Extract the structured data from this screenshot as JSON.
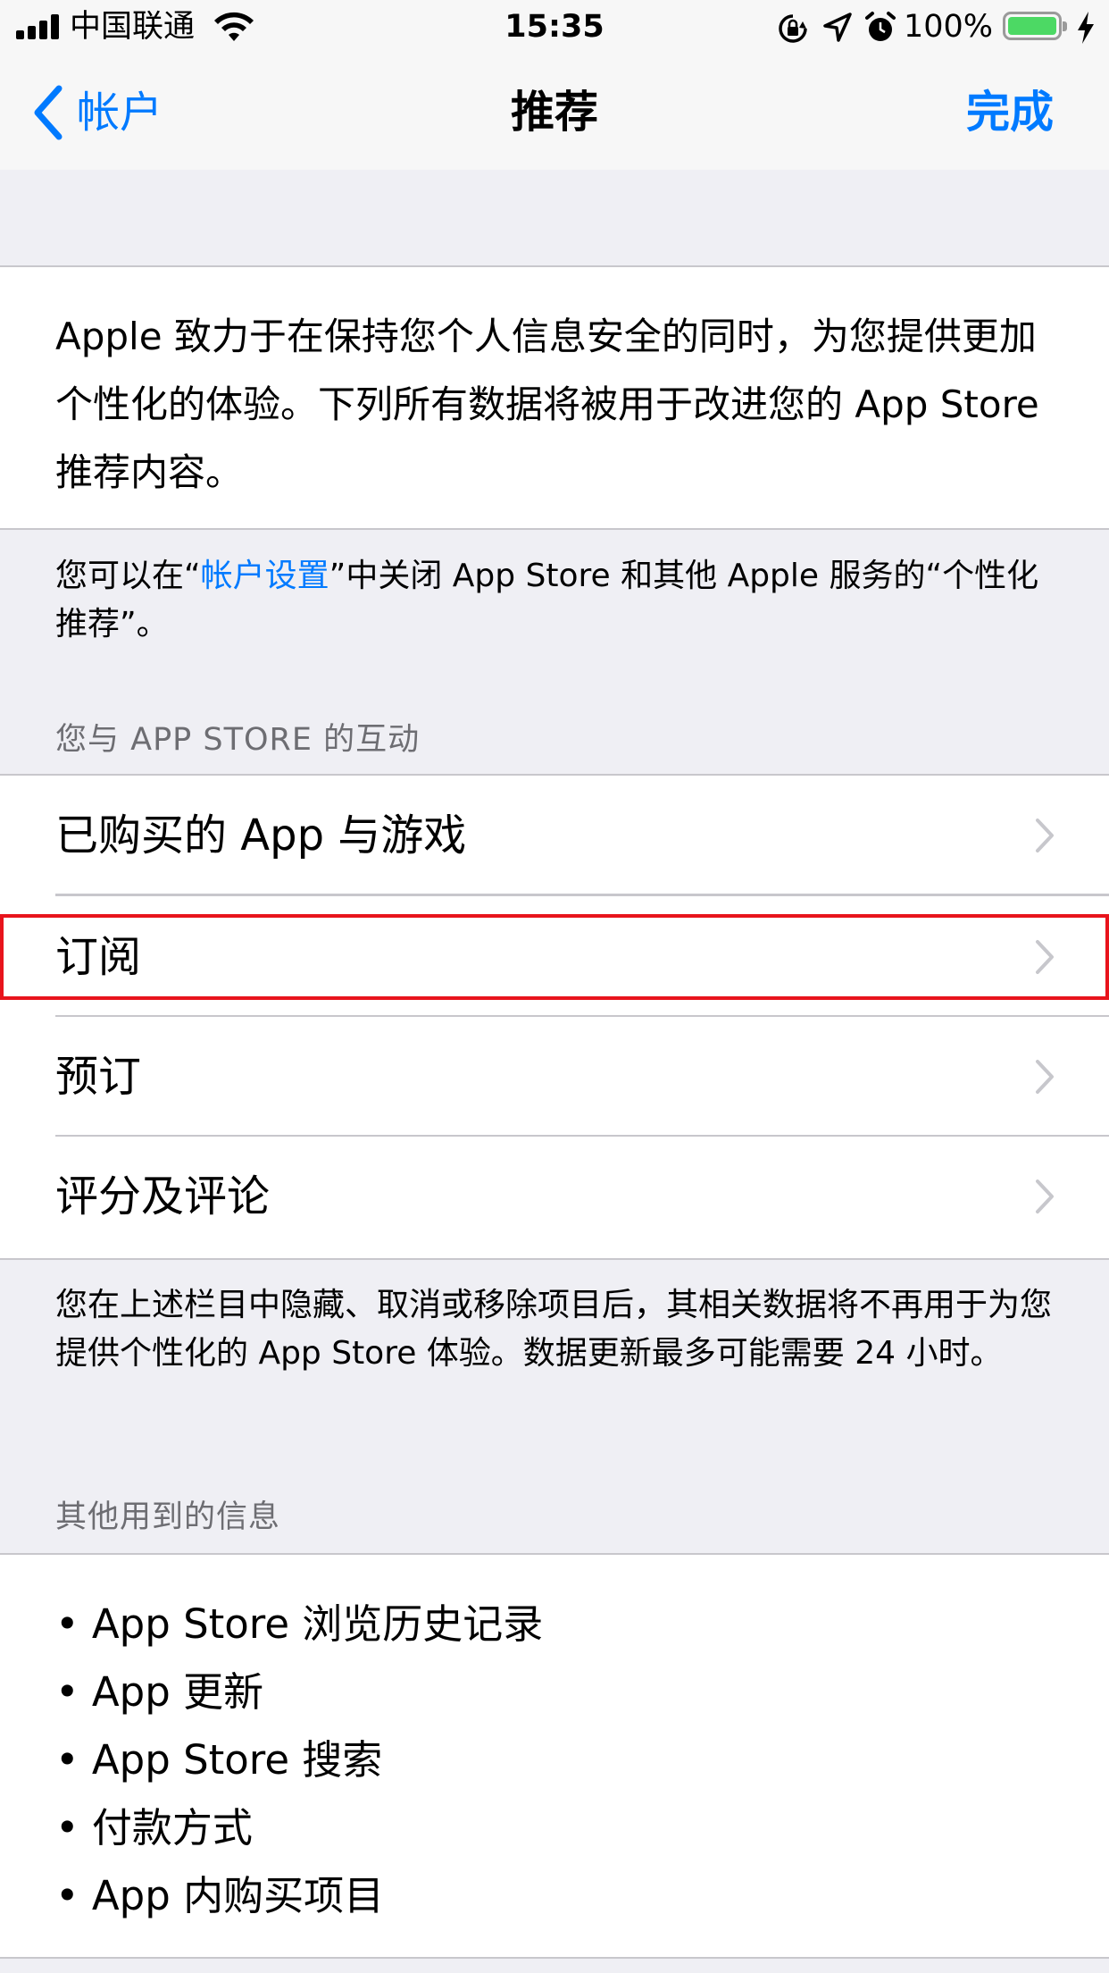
{
  "status_bar": {
    "carrier": "中国联通",
    "time": "15:35",
    "battery_percent": "100%",
    "battery_level": 1.0
  },
  "nav": {
    "back_label": "帐户",
    "title": "推荐",
    "done_label": "完成"
  },
  "intro": {
    "text": "Apple 致力于在保持您个人信息安全的同时，为您提供更加个性化的体验。下列所有数据将被用于改进您的 App Store 推荐内容。"
  },
  "settings_note": {
    "prefix": "您可以在“",
    "link": "帐户设置",
    "suffix": "”中关闭 App Store 和其他 Apple 服务的“个性化推荐”。"
  },
  "interactions_section": {
    "header": "您与 APP STORE 的互动",
    "rows": [
      {
        "label": "已购买的 App 与游戏"
      },
      {
        "label": "订阅"
      },
      {
        "label": "预订"
      },
      {
        "label": "评分及评论"
      }
    ],
    "footer": "您在上述栏目中隐藏、取消或移除项目后，其相关数据将不再用于为您提供个性化的 App Store 体验。数据更新最多可能需要 24 小时。"
  },
  "other_section": {
    "header": "其他用到的信息",
    "items": [
      {
        "text": "• App Store 浏览历史记录"
      },
      {
        "text": "• App 更新"
      },
      {
        "text": "• App Store 搜索"
      },
      {
        "text": "• 付款方式"
      },
      {
        "text": "• App 内购买项目"
      }
    ]
  },
  "colors": {
    "accent": "#007aff",
    "background": "#efeff4",
    "highlight": "#e8141c",
    "battery": "#4cd964"
  },
  "icons": [
    "signal-icon",
    "wifi-icon",
    "rotation-lock-icon",
    "location-icon",
    "alarm-icon",
    "battery-icon",
    "charging-icon",
    "back-chevron-icon",
    "chevron-right-icon"
  ]
}
